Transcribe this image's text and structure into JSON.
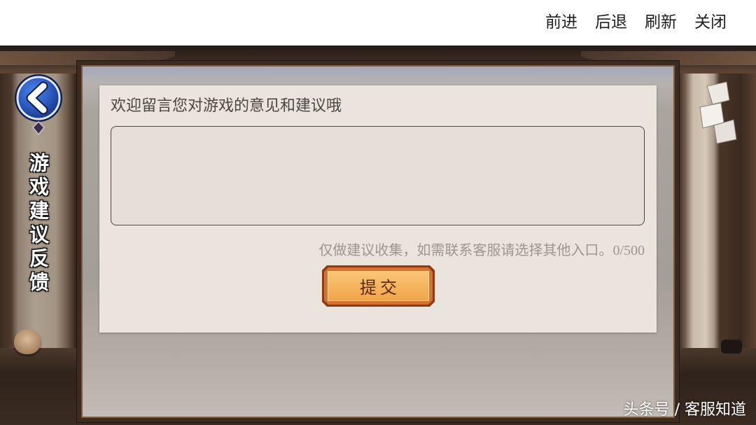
{
  "browser_toolbar": {
    "forward_label": "前进",
    "back_label": "后退",
    "refresh_label": "刷新",
    "close_label": "关闭"
  },
  "sidebar": {
    "back_button_icon": "chevron-left-icon",
    "title": "游戏建议反馈"
  },
  "feedback_form": {
    "prompt": "欢迎留言您对游戏的意见和建议哦",
    "input_value": "",
    "hint": "仅做建议收集，如需联系客服请选择其他入口。",
    "char_count": "0/500",
    "submit_label": "提交"
  },
  "watermark": "头条号 / 客服知道",
  "colors": {
    "toolbar_bg": "#ffffff",
    "panel_bg": "#ebe4dc",
    "submit_fill": "#f4ae58",
    "submit_border": "#8e3a16",
    "back_button": "#2a56bd"
  }
}
